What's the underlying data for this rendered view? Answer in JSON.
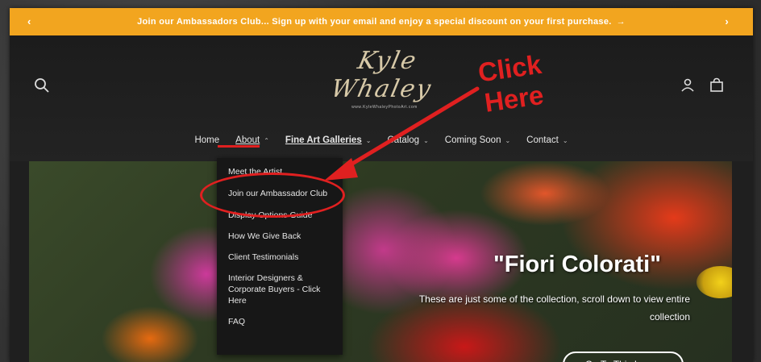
{
  "announcement": {
    "text": "Join our Ambassadors Club... Sign up with your email and enjoy a special discount on your first purchase.",
    "arrow": "→",
    "prev_icon": "‹",
    "next_icon": "›"
  },
  "header": {
    "logo_text": "Kyle Whaley",
    "logo_url": "www.KyleWhaleyPhotoArt.com",
    "icons": {
      "search": "search-icon",
      "account": "account-icon",
      "cart": "cart-icon"
    }
  },
  "annotation": {
    "click_here": "Click Here",
    "color": "#e02020"
  },
  "nav": {
    "items": [
      {
        "label": "Home",
        "chevron": ""
      },
      {
        "label": "About",
        "chevron": "⌃"
      },
      {
        "label": "Fine Art Galleries",
        "chevron": "⌄"
      },
      {
        "label": "Catalog",
        "chevron": "⌄"
      },
      {
        "label": "Coming Soon",
        "chevron": "⌄"
      },
      {
        "label": "Contact",
        "chevron": "⌄"
      }
    ]
  },
  "dropdown": {
    "items": [
      "Meet the Artist",
      "Join our Ambassador Club",
      "Display Options Guide",
      "How We Give Back",
      "Client Testimonials",
      "Interior Designers & Corporate Buyers - Click Here",
      "FAQ"
    ]
  },
  "hero": {
    "title": "\"Fiori Colorati\"",
    "subtitle": "These are just some of the collection, scroll down to view entire collection",
    "button": "Go To This Image"
  },
  "colors": {
    "announcement_bg": "#f2a51f",
    "header_bg": "#1f1f1f",
    "annotation_red": "#e02020"
  }
}
